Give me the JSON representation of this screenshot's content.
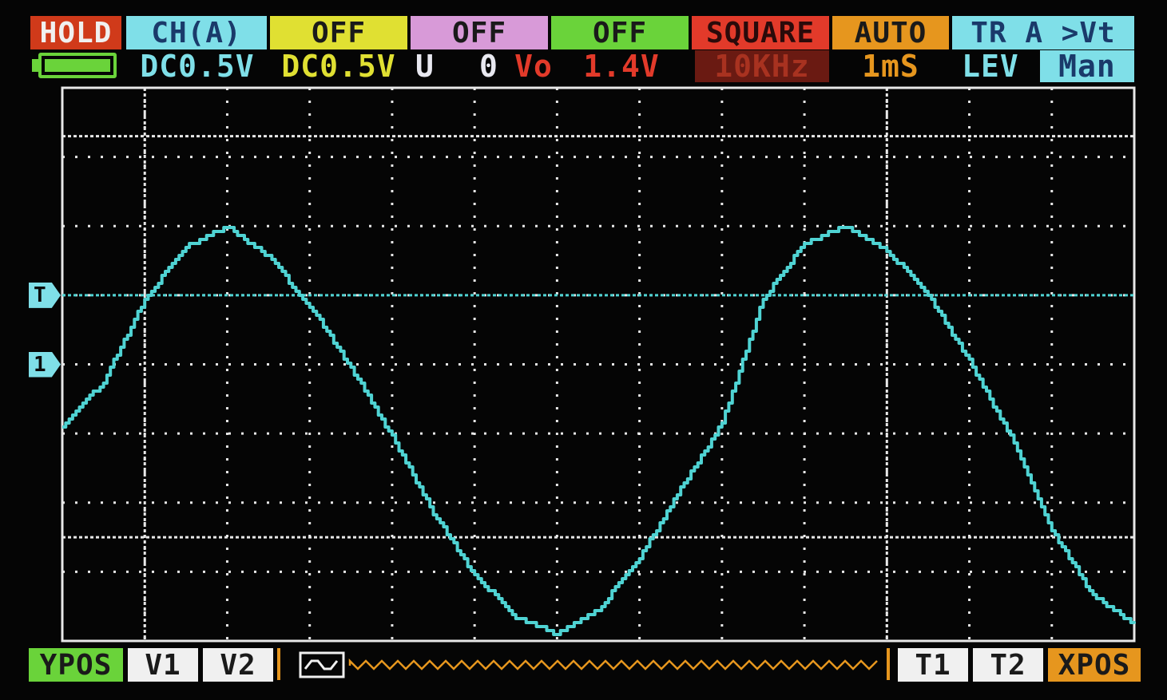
{
  "colors": {
    "background": "#050505",
    "trace": "#4fd3d3",
    "grid": "#e8e8e8",
    "cyan_accent": "#7fdfe8",
    "hold_bg": "#d03a1a",
    "yellow": "#e0e032",
    "pink": "#d89ad8",
    "green": "#6ad33a",
    "orange": "#e6961e",
    "red": "#e23a2a",
    "darkred": "#7a1e14"
  },
  "top_bar": {
    "hold": "HOLD",
    "channel": "CH(A)",
    "off_1": "OFF",
    "off_2": "OFF",
    "off_3": "OFF",
    "wave_type": "SQUARE",
    "mode": "AUTO",
    "trigger": "TR A >Vt"
  },
  "status_bar": {
    "battery_icon": "battery-full-icon",
    "ch_a_scale": "DC0.5V",
    "ch_b_scale": "DC0.5V",
    "u_label": "U",
    "u_value": "0",
    "vo_label": "Vo",
    "vo_value": "1.4V",
    "frequency": "10KHz",
    "timebase": "1mS",
    "lev_label": "LEV",
    "lev_mode": "Man"
  },
  "markers": {
    "trigger": "T",
    "channel_1": "1"
  },
  "bottom_bar": {
    "ypos": "YPOS",
    "v1": "V1",
    "v2": "V2",
    "wave_icon": "waveform-window-icon",
    "t1": "T1",
    "t2": "T2",
    "xpos": "XPOS"
  },
  "chart_data": {
    "type": "line",
    "grid": true,
    "x_divisions": 13,
    "y_divisions": 8,
    "series": [
      {
        "x": [
          0,
          0.5,
          1,
          1.5,
          2,
          2.5,
          3,
          3.5,
          4,
          4.5,
          5,
          5.5,
          6,
          6.5,
          7,
          7.5,
          8,
          8.5,
          9,
          9.5,
          10,
          10.5,
          11,
          11.5,
          12,
          12.5,
          13
        ],
        "y": [
          3.1,
          3.75,
          4.95,
          5.7,
          6.0,
          5.55,
          4.85,
          3.95,
          2.95,
          1.85,
          0.95,
          0.35,
          0.1,
          0.45,
          1.2,
          2.2,
          3.15,
          4.95,
          5.75,
          6.0,
          5.65,
          5.0,
          4.05,
          2.95,
          1.6,
          0.65,
          0.25
        ]
      }
    ],
    "trigger_level_div": 5.0,
    "channel_1_offset_div": 4.0,
    "cursor_levels_div": [
      7.3,
      1.5
    ],
    "cursor_times_div": [
      1.0,
      10.0
    ]
  }
}
